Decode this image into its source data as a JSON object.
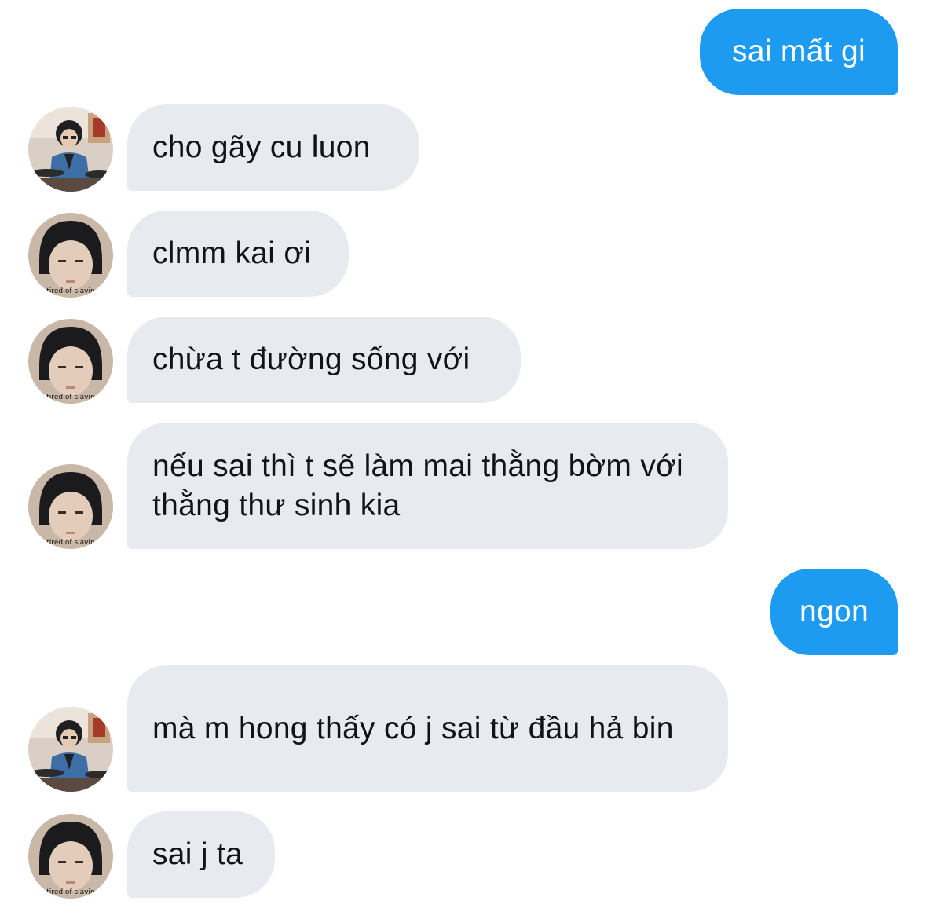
{
  "conversation": {
    "messages": [
      {
        "sender": "me",
        "text": "sai mất gi"
      },
      {
        "sender": "other",
        "avatar": "drummer-avatar",
        "text": "cho gãy cu luon"
      },
      {
        "sender": "other",
        "avatar": "portrait-avatar",
        "text": "clmm kai ơi"
      },
      {
        "sender": "other",
        "avatar": "portrait-avatar",
        "text": "chừa t đường sống với"
      },
      {
        "sender": "other",
        "avatar": "portrait-avatar",
        "text": "nếu sai thì t sẽ làm mai thằng bờm với thằng thư sinh kia"
      },
      {
        "sender": "me",
        "text": "ngon"
      },
      {
        "sender": "other",
        "avatar": "drummer-avatar",
        "text": "mà m hong thấy có j sai từ đầu hả bin"
      },
      {
        "sender": "other",
        "avatar": "portrait-avatar",
        "text": "sai j ta"
      }
    ],
    "avatar_caption": "tired of slavin"
  },
  "colors": {
    "outgoing_bubble": "#1d9bf0",
    "incoming_bubble": "#e7ebef",
    "incoming_text": "#0f1419",
    "outgoing_text": "#ffffff"
  }
}
